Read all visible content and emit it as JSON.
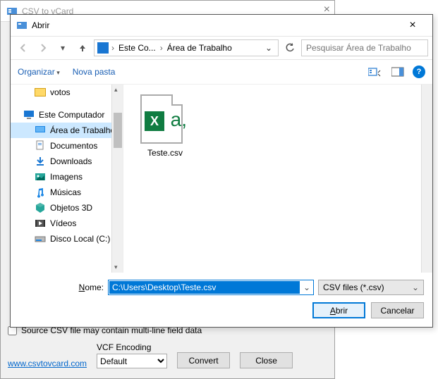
{
  "parent": {
    "title": "CSV to vCard",
    "checkbox_label": "Source CSV file may contain multi-line field data",
    "link": "www.csvtovcard.com",
    "vcf_label": "VCF Encoding",
    "vcf_value": "Default",
    "convert": "Convert",
    "close": "Close"
  },
  "dialog": {
    "title": "Abrir",
    "breadcrumb": {
      "item1": "Este Co...",
      "item2": "Área de Trabalho"
    },
    "search_placeholder": "Pesquisar Área de Trabalho",
    "organize": "Organizar",
    "new_folder": "Nova pasta",
    "tree": {
      "votos": "votos",
      "este_pc": "Este Computador",
      "desktop": "Área de Trabalho",
      "documents": "Documentos",
      "downloads": "Downloads",
      "images": "Imagens",
      "music": "Músicas",
      "objects3d": "Objetos 3D",
      "videos": "Vídeos",
      "disk": "Disco Local (C:)"
    },
    "file": {
      "name": "Teste.csv"
    },
    "name_label": "Nome:",
    "name_value": "C:\\Users\\Desktop\\Teste.csv",
    "filter": "CSV files (*.csv)",
    "open": "Abrir",
    "cancel": "Cancelar"
  }
}
